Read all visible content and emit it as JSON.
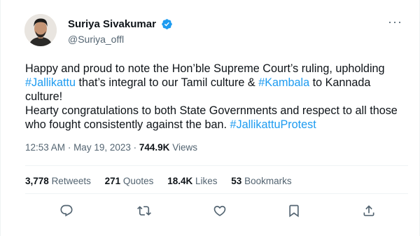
{
  "tweet": {
    "display_name": "Suriya Sivakumar",
    "handle": "@Suriya_offl",
    "more_label": "···",
    "text": [
      {
        "t": "text",
        "v": "Happy and proud to note the Hon’ble Supreme Court’s ruling, upholding "
      },
      {
        "t": "tag",
        "v": "#Jallikattu"
      },
      {
        "t": "text",
        "v": " that’s integral to our Tamil culture & "
      },
      {
        "t": "tag",
        "v": "#Kambala"
      },
      {
        "t": "text",
        "v": " to Kannada culture!"
      },
      {
        "t": "br"
      },
      {
        "t": "text",
        "v": "Hearty congratulations to both State Governments and respect to all those who fought consistently against the ban. "
      },
      {
        "t": "tag",
        "v": "#JallikattuProtest"
      }
    ],
    "time": "12:53 AM",
    "date": "May 19, 2023",
    "views_count": "744.9K",
    "views_label": "Views",
    "retweets_count": "3,778",
    "retweets_label": "Retweets",
    "quotes_count": "271",
    "quotes_label": "Quotes",
    "likes_count": "18.4K",
    "likes_label": "Likes",
    "bookmarks_count": "53",
    "bookmarks_label": "Bookmarks",
    "actions": [
      "reply-icon",
      "retweet-icon",
      "like-icon",
      "bookmark-icon",
      "share-icon"
    ]
  },
  "colors": {
    "accent": "#1d9bf0",
    "text": "#0f1419",
    "secondary": "#536471",
    "border": "#eff3f4"
  }
}
